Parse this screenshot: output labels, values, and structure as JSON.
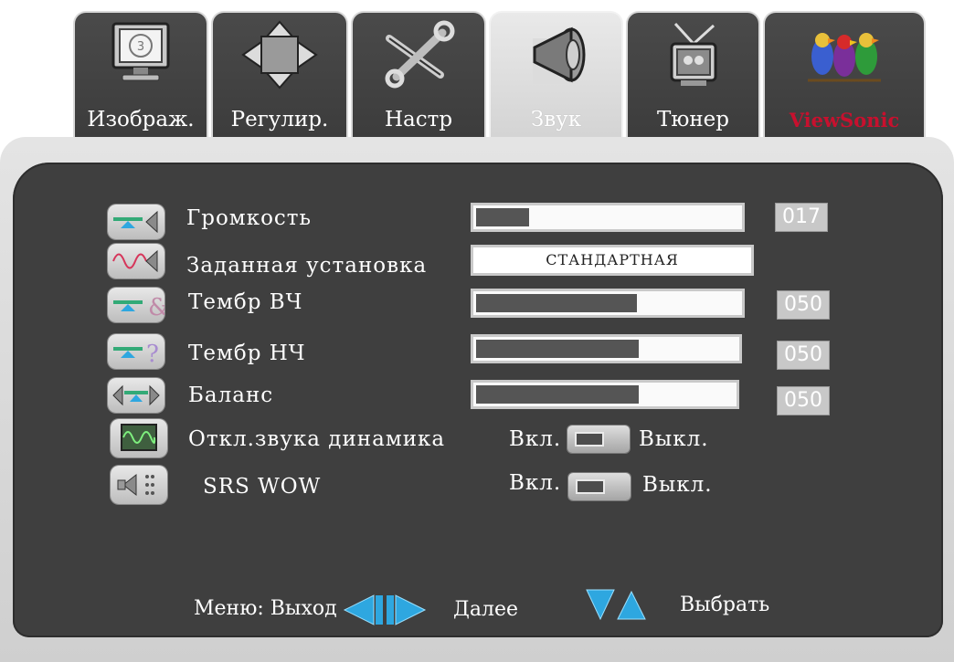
{
  "tabs": [
    {
      "label": "Изображ.",
      "icon": "monitor-icon"
    },
    {
      "label": "Регулир.",
      "icon": "adjust-arrows-icon"
    },
    {
      "label": "Настр",
      "icon": "tools-icon"
    },
    {
      "label": "Звук",
      "icon": "speaker-icon",
      "active": true
    },
    {
      "label": "Тюнер",
      "icon": "tv-antenna-icon"
    },
    {
      "label": "ViewSonic",
      "icon": "viewsonic-logo-icon"
    }
  ],
  "rows": {
    "volume": {
      "label": "Громкость",
      "value": "017",
      "level": 17,
      "icon": "volume-icon"
    },
    "preset": {
      "label": "Заданная установка",
      "value": "СТАНДАРТНАЯ",
      "icon": "preset-wave-icon"
    },
    "treble": {
      "label": "Тембр ВЧ",
      "value": "050",
      "level": 50,
      "icon": "treble-clef-icon"
    },
    "bass": {
      "label": "Тембр НЧ",
      "value": "050",
      "level": 50,
      "icon": "bass-clef-icon"
    },
    "balance": {
      "label": "Баланс",
      "value": "050",
      "level": 50,
      "icon": "balance-icon"
    },
    "speaker_mute": {
      "label": "Откл.звука динамика",
      "on_label": "Вкл.",
      "off_label": "Выкл.",
      "icon": "oscilloscope-icon"
    },
    "srs_wow": {
      "label": "SRS WOW",
      "on_label": "Вкл.",
      "off_label": "Выкл.",
      "icon": "srs-speaker-icon"
    }
  },
  "footer": {
    "menu_exit": "Меню: Выход",
    "next": "Далее",
    "select": "Выбрать"
  },
  "colors": {
    "panel": "#3f3f3f",
    "frame": "#d9d9d9",
    "accent_blue": "#2ea7e0",
    "viewsonic_red": "#c8102e"
  }
}
